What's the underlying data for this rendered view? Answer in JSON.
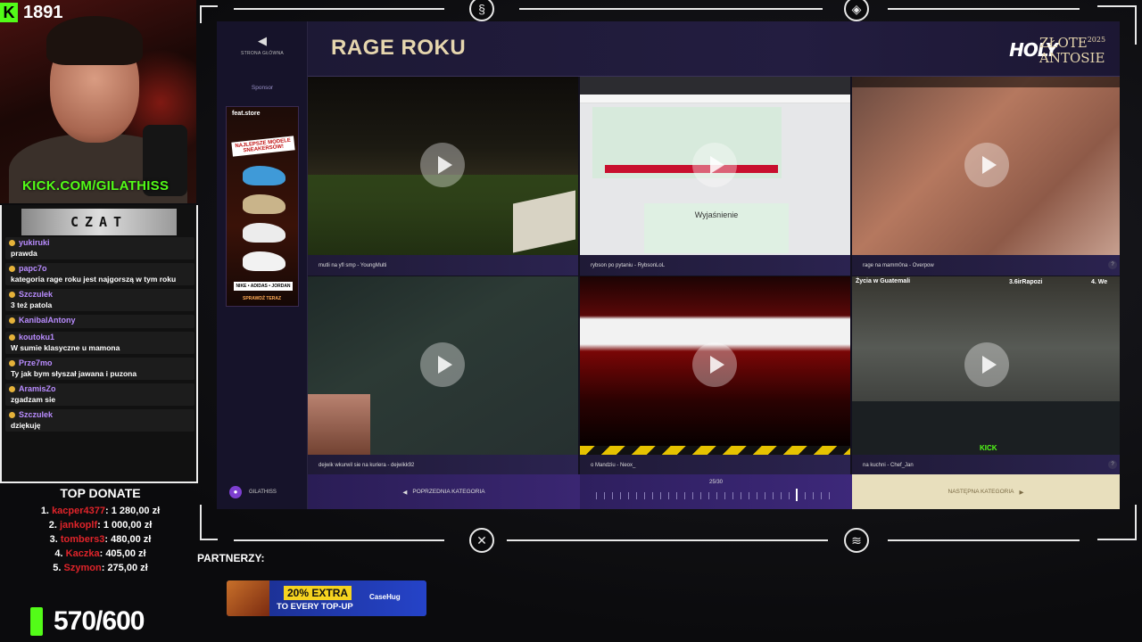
{
  "overlay": {
    "kick_count": "1891",
    "kick_url": "KICK.COM/GILATHISS",
    "chat_title": "CZAT",
    "chat": [
      {
        "user": "yukiruki",
        "text": "prawda"
      },
      {
        "user": "papc7o",
        "text": "kategoria rage roku jest najgorszą w tym roku"
      },
      {
        "user": "Szczulek",
        "text": "3 też patola"
      },
      {
        "user": "KanibalAntony",
        "text": ""
      },
      {
        "user": "koutoku1",
        "text": "W sumie klasyczne u mamona"
      },
      {
        "user": "Prze7mo",
        "text": "Ty jak bym słyszał jawana i puzona"
      },
      {
        "user": "AramisZo",
        "text": "zgadzam sie"
      },
      {
        "user": "Szczulek",
        "text": "dziękuję"
      }
    ],
    "top_donate_title": "TOP DONATE",
    "donations": [
      {
        "n": "1.",
        "name": "kacper4377",
        "amount": ": 1 280,00 zł"
      },
      {
        "n": "2.",
        "name": "jankoplf",
        "amount": ": 1 000,00 zł"
      },
      {
        "n": "3.",
        "name": "tombers3",
        "amount": ": 480,00 zł"
      },
      {
        "n": "4.",
        "name": "Kaczka",
        "amount": ": 405,00 zł"
      },
      {
        "n": "5.",
        "name": "Szymon",
        "amount": ": 275,00 zł"
      }
    ],
    "goal": "570/600",
    "partners_label": "PARTNERZY:",
    "promo": {
      "pct": "20% EXTRA",
      "sub": "TO EVERY TOP-UP",
      "brand": "CaseHug"
    }
  },
  "app": {
    "back_label": "STRONA GŁÓWNA",
    "sponsor_label": "Sponsor",
    "sponsor_ad": {
      "brand": "feat.store",
      "headline": "NAJLEPSZE MODELE SNEAKERSÓW!",
      "tag": "NIKE • ADIDAS • JORDAN",
      "cta": "SPRAWDŹ TERAZ"
    },
    "title": "RAGE ROKU",
    "logo_holy": "HOLY",
    "logo_zlote": "ZŁOTE",
    "logo_year": "2025",
    "logo_antosie": "ANTOSIE",
    "videos": [
      {
        "caption": "mutli na yfl smp - YoungMulti"
      },
      {
        "caption": "rybson po pytaniu - RybsonLoL",
        "explain": "Wyjaśnienie"
      },
      {
        "caption": "rage na mamm0na - Overpow"
      },
      {
        "caption": "dejwik wkurwil sie na kuriera - dejwikk92"
      },
      {
        "caption": "o Mandziu - Neox_"
      },
      {
        "caption": "na kuchni - Chef_Jan",
        "overlay_label": "Życia w Guatemali",
        "rank1": "3.6irRapozi",
        "rank2": "4. We",
        "kick_label": "KICK"
      }
    ],
    "footer": {
      "user": "GILATHISS",
      "prev": "POPRZEDNIA KATEGORIA",
      "progress": "25/30",
      "progress_fraction": 0.83,
      "next": "NASTĘPNA KATEGORIA"
    }
  }
}
